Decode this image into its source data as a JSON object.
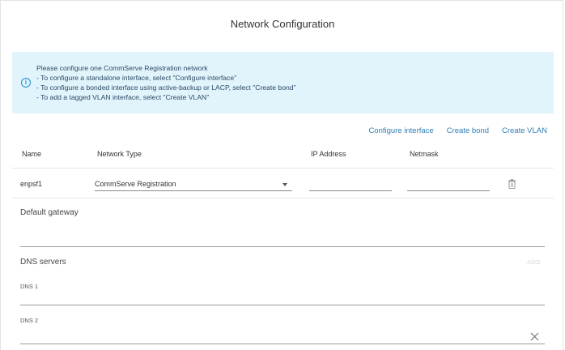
{
  "dialog": {
    "title": "Network Configuration"
  },
  "info": {
    "lines": [
      "Please configure one CommServe Registration network",
      "- To configure a standalone interface, select \"Configure interface\"",
      "- To configure a bonded interface using active-backup or LACP, select \"Create bond\"",
      "- To add a tagged VLAN interface, select \"Create VLAN\""
    ]
  },
  "actions": {
    "configure_interface": "Configure interface",
    "create_bond": "Create bond",
    "create_vlan": "Create VLAN"
  },
  "table": {
    "headers": {
      "name": "Name",
      "network_type": "Network Type",
      "ip_address": "IP Address",
      "netmask": "Netmask"
    },
    "rows": [
      {
        "name": "enpsf1",
        "network_type": "CommServe Registration",
        "ip_address": "",
        "netmask": ""
      }
    ]
  },
  "gateway": {
    "label": "Default gateway",
    "value": ""
  },
  "dns": {
    "label": "DNS servers",
    "add_label": "ADD",
    "dns1_label": "DNS 1",
    "dns1_value": "",
    "dns2_label": "DNS 2",
    "dns2_value": ""
  },
  "colors": {
    "accent": "#2e7db5",
    "info_bg": "#e2f4fb",
    "info_icon": "#1a8fcf"
  },
  "icons": {
    "info": "info-circle-icon",
    "delete": "trash-icon",
    "close": "close-icon",
    "dropdown": "caret-down-icon"
  }
}
